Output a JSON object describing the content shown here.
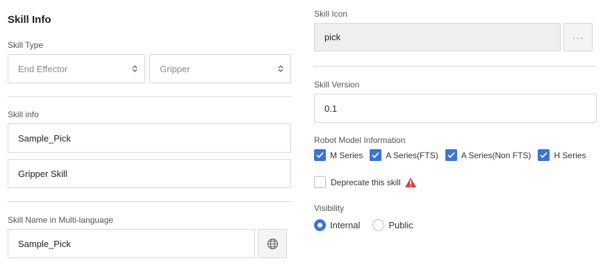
{
  "skill_info": {
    "heading": "Skill Info",
    "skill_type_label": "Skill Type",
    "type_select": "End Effector",
    "subtype_select": "Gripper",
    "info_label": "Skill info",
    "info_name_value": "Sample_Pick",
    "info_desc_value": "Gripper Skill",
    "multilang_label": "Skill Name in Multi-language",
    "multilang_value": "Sample_Pick"
  },
  "skill_icon": {
    "label": "Skill Icon",
    "value": "pick",
    "browse_button": "···"
  },
  "skill_version": {
    "label": "Skill Version",
    "value": "0.1"
  },
  "robot_model": {
    "label": "Robot Model Information",
    "options": [
      {
        "label": "M Series",
        "checked": true
      },
      {
        "label": "A Series(FTS)",
        "checked": true
      },
      {
        "label": "A Series(Non FTS)",
        "checked": true
      },
      {
        "label": "H Series",
        "checked": true
      }
    ]
  },
  "deprecate": {
    "label": "Deprecate this skill",
    "checked": false,
    "warning_icon": "warning-icon",
    "warning_color": "#e03c3c"
  },
  "visibility": {
    "label": "Visibility",
    "options": [
      {
        "label": "Internal",
        "selected": true
      },
      {
        "label": "Public",
        "selected": false
      }
    ]
  },
  "colors": {
    "accent": "#3b73d9",
    "border": "#d6d6d6"
  }
}
